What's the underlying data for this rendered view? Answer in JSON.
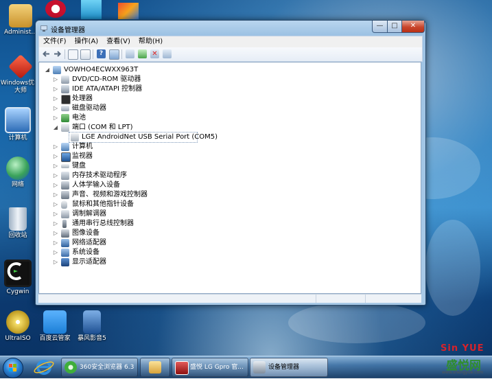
{
  "desktop": {
    "icons": [
      {
        "label": "Administ...",
        "icon": "user-folder-icon",
        "color": "#e7b94d"
      },
      {
        "label": "Windows优化大师",
        "icon": "windows-optimizer-icon",
        "color": "#d93a2b"
      },
      {
        "label": "计算机",
        "icon": "computer-icon",
        "color": "#4b8ed6"
      },
      {
        "label": "网络",
        "icon": "network-icon",
        "color": "#3aa35a"
      },
      {
        "label": "回收站",
        "icon": "recycle-bin-icon",
        "color": "#c9d4df"
      },
      {
        "label": "Cygwin",
        "icon": "cygwin-icon",
        "color": "#1d1d1d"
      },
      {
        "label": "UltraISO",
        "icon": "ultraiso-icon",
        "color": "#e8d35a"
      },
      {
        "label": "百度云管家",
        "icon": "baidu-cloud-icon",
        "color": "#2d8fe0"
      },
      {
        "label": "暴风影音5",
        "icon": "baofeng-player-icon",
        "color": "#2f6fb5"
      }
    ]
  },
  "window": {
    "title": "设备管理器",
    "controls": {
      "minimize": "—",
      "maximize": "□",
      "close": "✕"
    },
    "menu": [
      "文件(F)",
      "操作(A)",
      "查看(V)",
      "帮助(H)"
    ],
    "toolbar_icons": [
      "back-icon",
      "forward-icon",
      "show-hide-console-tree-icon",
      "properties-icon",
      "help-icon",
      "computer-view-icon",
      "scan-hardware-icon",
      "update-driver-icon",
      "uninstall-icon",
      "disable-icon"
    ],
    "tree": {
      "root": "VOWHO4ECWXX963T",
      "nodes": [
        {
          "label": "DVD/CD-ROM 驱动器",
          "icon": "dvd-drive-icon",
          "expanded": false,
          "level": 1
        },
        {
          "label": "IDE ATA/ATAPI 控制器",
          "icon": "ide-controller-icon",
          "expanded": false,
          "level": 1
        },
        {
          "label": "处理器",
          "icon": "processor-icon",
          "expanded": false,
          "level": 1
        },
        {
          "label": "磁盘驱动器",
          "icon": "disk-drive-icon",
          "expanded": false,
          "level": 1
        },
        {
          "label": "电池",
          "icon": "battery-icon",
          "expanded": false,
          "level": 1
        },
        {
          "label": "端口 (COM 和 LPT)",
          "icon": "port-icon",
          "expanded": true,
          "level": 1
        },
        {
          "label": "LGE AndroidNet USB Serial Port (COM5)",
          "icon": "serial-port-icon",
          "expanded": null,
          "level": 2,
          "selected": true
        },
        {
          "label": "计算机",
          "icon": "computer-icon",
          "expanded": false,
          "level": 1
        },
        {
          "label": "监视器",
          "icon": "monitor-icon",
          "expanded": false,
          "level": 1
        },
        {
          "label": "键盘",
          "icon": "keyboard-icon",
          "expanded": false,
          "level": 1
        },
        {
          "label": "内存技术驱动程序",
          "icon": "memory-driver-icon",
          "expanded": false,
          "level": 1
        },
        {
          "label": "人体学输入设备",
          "icon": "hid-icon",
          "expanded": false,
          "level": 1
        },
        {
          "label": "声音、视频和游戏控制器",
          "icon": "sound-icon",
          "expanded": false,
          "level": 1
        },
        {
          "label": "鼠标和其他指针设备",
          "icon": "mouse-icon",
          "expanded": false,
          "level": 1
        },
        {
          "label": "调制解调器",
          "icon": "modem-icon",
          "expanded": false,
          "level": 1
        },
        {
          "label": "通用串行总线控制器",
          "icon": "usb-controller-icon",
          "expanded": false,
          "level": 1
        },
        {
          "label": "图像设备",
          "icon": "imaging-device-icon",
          "expanded": false,
          "level": 1
        },
        {
          "label": "网络适配器",
          "icon": "network-adapter-icon",
          "expanded": false,
          "level": 1
        },
        {
          "label": "系统设备",
          "icon": "system-device-icon",
          "expanded": false,
          "level": 1
        },
        {
          "label": "显示适配器",
          "icon": "display-adapter-icon",
          "expanded": false,
          "level": 1
        }
      ]
    }
  },
  "taskbar": {
    "pinned": [
      {
        "name": "internet-explorer-icon",
        "color": "#2f8fe0"
      }
    ],
    "tasks": [
      {
        "label": "360安全浏览器 6.3",
        "icon": "360-browser-icon",
        "color": "#3fae3a",
        "active": false
      },
      {
        "label": "",
        "icon": "explorer-folder-icon",
        "color": "#e9c35a",
        "active": false
      },
      {
        "label": "盛悦 LG Gpro 官...",
        "icon": "lg-tool-icon",
        "color": "#b21f1f",
        "active": false
      },
      {
        "label": "设备管理器",
        "icon": "device-manager-icon",
        "color": "#8a97a6",
        "active": true
      }
    ]
  },
  "watermark": {
    "line1": "Sin YUE",
    "line2": "盛悦网",
    "line3": "www.shengyue.com"
  }
}
